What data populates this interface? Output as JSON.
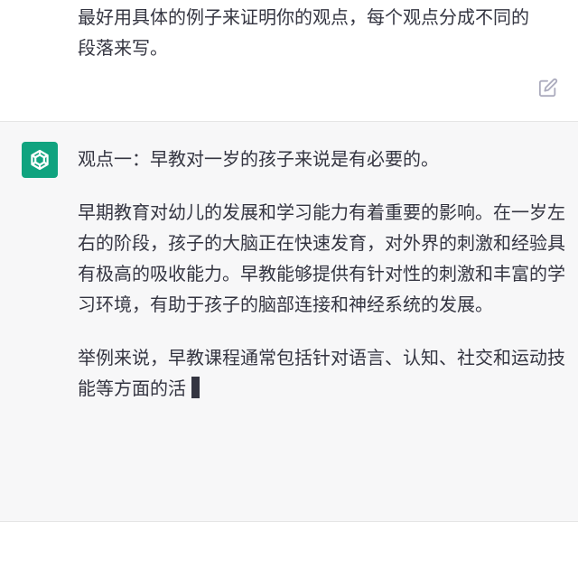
{
  "user_message": {
    "text": "最好用具体的例子来证明你的观点，每个观点分成不同的\n段落来写。",
    "edit_icon": "edit-icon"
  },
  "assistant_message": {
    "avatar_icon": "openai-logo-icon",
    "avatar_color": "#10a37f",
    "paragraphs": [
      "观点一：早教对一岁的孩子来说是有必要的。",
      "早期教育对幼儿的发展和学习能力有着重要的影响。在一岁左右的阶段，孩子的大脑正在快速发育，对外界的刺激和经验具有极高的吸收能力。早教能够提供有针对性的刺激和丰富的学习环境，有助于孩子的脑部连接和神经系统的发展。",
      "举例来说，早教课程通常包括针对语言、认知、社交和运动技能等方面的活"
    ]
  }
}
